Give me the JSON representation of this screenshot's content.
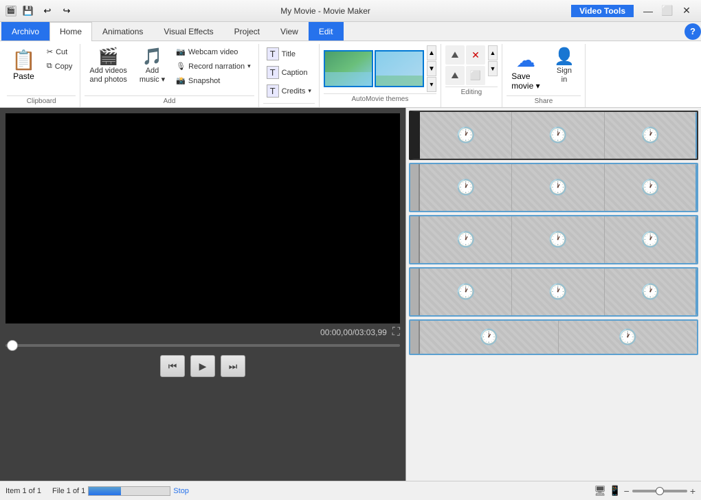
{
  "titlebar": {
    "app_name": "My Movie - Movie Maker",
    "video_tools_label": "Video Tools",
    "quick_buttons": [
      "💾",
      "↩",
      "↪"
    ],
    "controls": [
      "—",
      "⬜",
      "✕"
    ]
  },
  "tabs": [
    {
      "id": "archivo",
      "label": "Archivo",
      "active": false,
      "special": "archivo"
    },
    {
      "id": "home",
      "label": "Home",
      "active": true
    },
    {
      "id": "animations",
      "label": "Animations"
    },
    {
      "id": "visual_effects",
      "label": "Visual Effects"
    },
    {
      "id": "project",
      "label": "Project"
    },
    {
      "id": "view",
      "label": "View"
    },
    {
      "id": "edit",
      "label": "Edit",
      "special": "edit-tab"
    }
  ],
  "ribbon": {
    "groups": {
      "clipboard": {
        "label": "Clipboard",
        "paste_label": "Paste",
        "cut_label": "Cut",
        "copy_label": "Copy"
      },
      "add": {
        "label": "Add",
        "add_videos_label": "Add videos\nand photos",
        "add_music_label": "Add\nmusic",
        "webcam_label": "Webcam video",
        "record_narration_label": "Record narration",
        "snapshot_label": "Snapshot"
      },
      "text": {
        "title_label": "Title",
        "caption_label": "Caption",
        "credits_label": "Credits"
      },
      "automovie": {
        "label": "AutoMovie themes"
      },
      "editing": {
        "label": "Editing"
      },
      "share": {
        "label": "Share",
        "save_movie_label": "Save\nmovie",
        "sign_in_label": "Sign\nin"
      }
    }
  },
  "video": {
    "time_display": "00:00,00/03:03,99"
  },
  "controls": {
    "prev": "⏮",
    "play": "▶",
    "next": "⏭"
  },
  "status": {
    "item_info": "Item 1 of 1",
    "file_info": "File 1 of 1",
    "stop_label": "Stop",
    "progress_percent": 40
  },
  "timeline": {
    "strips": [
      {
        "id": 1,
        "cells": 4,
        "type": "first"
      },
      {
        "id": 2,
        "cells": 4,
        "type": "normal"
      },
      {
        "id": 3,
        "cells": 4,
        "type": "normal"
      },
      {
        "id": 4,
        "cells": 4,
        "type": "normal"
      },
      {
        "id": 5,
        "cells": 4,
        "type": "partial"
      }
    ]
  },
  "icons": {
    "paste": "📋",
    "cut": "✂",
    "copy": "⧉",
    "add_videos": "🎬",
    "add_music": "🎵",
    "webcam": "📷",
    "record": "🎙",
    "snapshot": "📸",
    "title": "T",
    "caption": "💬",
    "credits": "📜",
    "save_movie": "☁",
    "sign_in": "👤",
    "help": "?",
    "fullscreen": "⛶",
    "clock": "🕐"
  }
}
